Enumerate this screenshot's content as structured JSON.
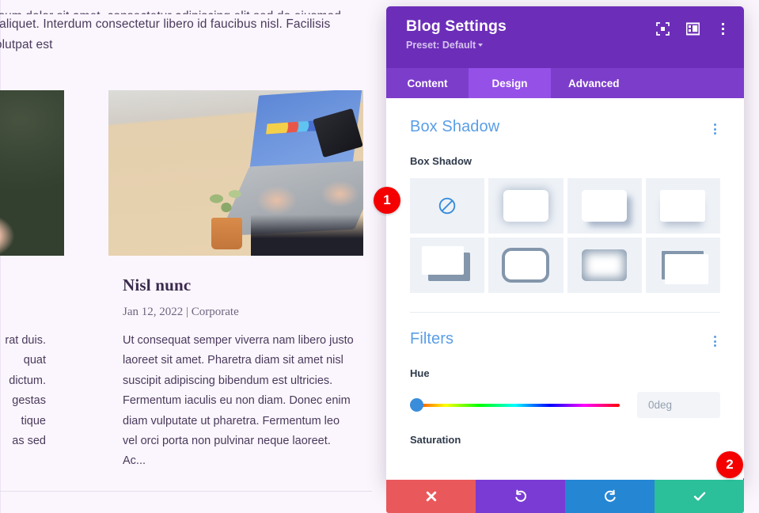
{
  "background_page": {
    "intro_paragraph": "a aliquet. Interdum consectetur libero id faucibus nisl. Facilisis volutpat est",
    "clipped_top_line": "ipsum dolor sit amet, consectetur adipiscing elit sed do eiusmod tempor",
    "post": {
      "title": "Nisl nunc",
      "meta": "Jan 12, 2022 | Corporate",
      "excerpt": "Ut consequat semper viverra nam libero justo laoreet sit amet. Pharetra diam sit amet nisl suscipit adipiscing bibendum est ultricies. Fermentum iaculis eu non diam. Donec enim diam vulputate ut pharetra. Fermentum leo vel orci porta non pulvinar neque laoreet. Ac..."
    },
    "left_column_fragment_lines": [
      "rat duis.",
      "quat",
      "dictum.",
      "gestas",
      "tique",
      "as sed"
    ],
    "images": [
      {
        "name": "person-with-pen-photo"
      },
      {
        "name": "laptop-on-desk-photo"
      }
    ]
  },
  "modal": {
    "title": "Blog Settings",
    "preset_label": "Preset: Default",
    "header_icons": [
      {
        "name": "focus-mode-icon"
      },
      {
        "name": "view-layout-icon"
      },
      {
        "name": "more-options-icon"
      }
    ],
    "tabs": [
      {
        "label": "Content",
        "active": false
      },
      {
        "label": "Design",
        "active": true
      },
      {
        "label": "Advanced",
        "active": false
      }
    ],
    "sections": {
      "box_shadow": {
        "title": "Box Shadow",
        "field_label": "Box Shadow",
        "options": [
          {
            "name": "none",
            "selected": false
          },
          {
            "name": "preset-1",
            "selected": false
          },
          {
            "name": "preset-2",
            "selected": false
          },
          {
            "name": "preset-3",
            "selected": false
          },
          {
            "name": "preset-4",
            "selected": false
          },
          {
            "name": "preset-5",
            "selected": false
          },
          {
            "name": "preset-6",
            "selected": false
          },
          {
            "name": "preset-7",
            "selected": false
          }
        ]
      },
      "filters": {
        "title": "Filters",
        "hue": {
          "label": "Hue",
          "value": "0deg",
          "handle_percent": 0
        },
        "next_label": "Saturation"
      }
    },
    "footer_actions": [
      {
        "name": "cancel",
        "icon": "close-icon",
        "color": "#e9595b"
      },
      {
        "name": "undo",
        "icon": "undo-icon",
        "color": "#7a3bd4"
      },
      {
        "name": "redo",
        "icon": "redo-icon",
        "color": "#2586d4"
      },
      {
        "name": "save",
        "icon": "check-icon",
        "color": "#2bbf9a"
      }
    ]
  },
  "callouts": [
    {
      "number": "1"
    },
    {
      "number": "2"
    }
  ],
  "colors": {
    "header_purple": "#6c2eb9",
    "tab_bar_purple": "#7c3dcb",
    "tab_active_purple": "#9550e8",
    "section_title_blue": "#5a9ee6",
    "badge_red": "#f40000",
    "page_background": "#fbf6fd"
  }
}
